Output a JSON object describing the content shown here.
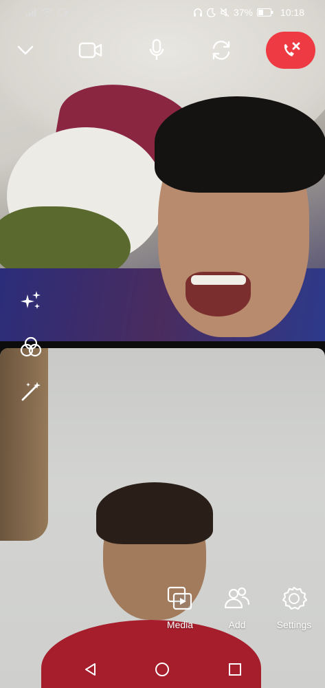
{
  "status_bar": {
    "battery": "37%",
    "time": "10:18"
  },
  "call_controls": {
    "minimize": "chevron-down-icon",
    "video": "video-camera-icon",
    "mic": "microphone-icon",
    "switch_camera": "switch-camera-icon",
    "end_call": "end-call-icon"
  },
  "effects": [
    "sparkles-icon",
    "filters-icon",
    "magic-wand-icon"
  ],
  "actions": {
    "media_label": "Media",
    "add_label": "Add",
    "settings_label": "Settings"
  },
  "nav": [
    "back-icon",
    "home-icon",
    "recents-icon"
  ],
  "colors": {
    "end_call": "#ee3a42",
    "icon": "#ffffff"
  }
}
